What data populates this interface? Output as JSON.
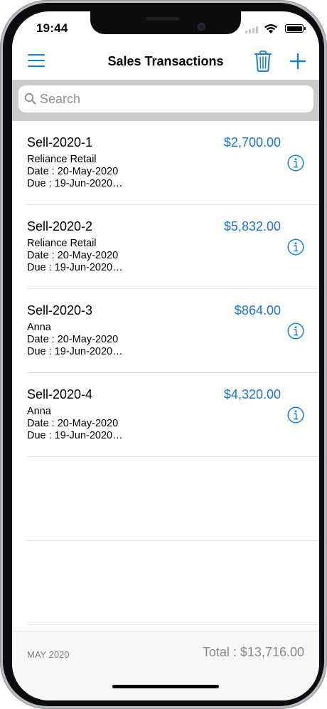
{
  "status_bar": {
    "time": "19:44"
  },
  "nav": {
    "title": "Sales Transactions",
    "menu_icon": "hamburger-menu-icon",
    "delete_icon": "trash-icon",
    "add_icon": "plus-icon"
  },
  "search": {
    "placeholder": "Search",
    "value": ""
  },
  "transactions": [
    {
      "id": "Sell-2020-1",
      "customer": "Reliance Retail",
      "date": "Date : 20-May-2020",
      "due": "Due : 19-Jun-2020…",
      "amount": "$2,700.00"
    },
    {
      "id": "Sell-2020-2",
      "customer": "Reliance Retail",
      "date": "Date : 20-May-2020",
      "due": "Due : 19-Jun-2020…",
      "amount": "$5,832.00"
    },
    {
      "id": "Sell-2020-3",
      "customer": "Anna",
      "date": "Date : 20-May-2020",
      "due": "Due : 19-Jun-2020…",
      "amount": "$864.00"
    },
    {
      "id": "Sell-2020-4",
      "customer": "Anna",
      "date": "Date : 20-May-2020",
      "due": "Due : 19-Jun-2020…",
      "amount": "$4,320.00"
    }
  ],
  "footer": {
    "month": "MAY 2020",
    "total": "Total : $13,716.00"
  },
  "colors": {
    "accent": "#1b7fd6",
    "amount": "#1b74d4",
    "search_bar_bg": "#cacaca",
    "footer_bg": "#f7f7f7"
  }
}
